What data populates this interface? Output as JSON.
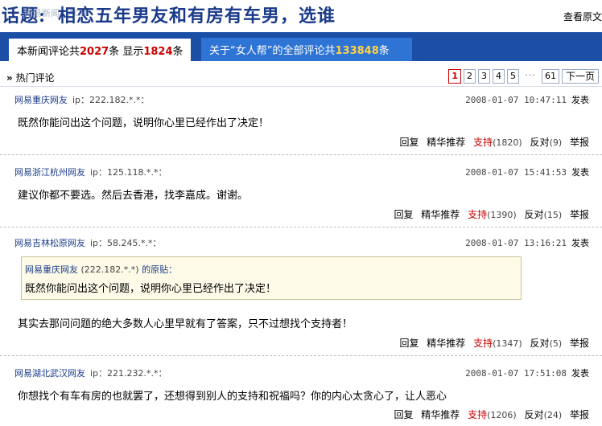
{
  "header": {
    "title_label": "话题:",
    "title": "相恋五年男友和有房有车男，选谁",
    "watermark": "网易新闻 · ACN",
    "view_link": "查看原文"
  },
  "tabs": {
    "active": {
      "prefix": "本新闻评论共",
      "count": "2027",
      "mid": "条 显示",
      "shown": "1824",
      "suffix": "条"
    },
    "inactive": {
      "prefix": "关于“女人帮”的全部评论共",
      "count": "133848",
      "suffix": "条"
    }
  },
  "hot": {
    "title": "热门评论",
    "arrow": "»",
    "pager": {
      "pages": [
        "1",
        "2",
        "3",
        "4",
        "5"
      ],
      "dots": "···",
      "last": "61",
      "next": "下一页"
    }
  },
  "comments": [
    {
      "user": "网易重庆网友",
      "ip": "ip：222.182.*.*：",
      "time": "2008-01-07 10:47:11",
      "post": "发表",
      "body": "既然你能问出这个问题，说明你心里已经作出了决定！",
      "actions": {
        "reply": "回复",
        "recommend": "精华推荐",
        "support": "支持",
        "support_count": "(1820)",
        "oppose": "反对",
        "oppose_count": "(9)",
        "report": "举报"
      }
    },
    {
      "user": "网易浙江杭州网友",
      "ip": "ip：125.118.*.*：",
      "time": "2008-01-07 15:41:53",
      "post": "发表",
      "body": "建议你都不要选。然后去香港，找李嘉成。谢谢。",
      "actions": {
        "reply": "回复",
        "recommend": "精华推荐",
        "support": "支持",
        "support_count": "(1390)",
        "oppose": "反对",
        "oppose_count": "(15)",
        "report": "举报"
      }
    },
    {
      "user": "网易吉林松原网友",
      "ip": "ip：58.245.*.*：",
      "time": "2008-01-07 13:16:21",
      "post": "发表",
      "quote": {
        "user": "网易重庆网友",
        "ip": "(222.182.*.*)",
        "label": "的原贴：",
        "body": "既然你能问出这个问题，说明你心里已经作出了决定！"
      },
      "body": "其实去那问问题的绝大多数人心里早就有了答案，只不过想找个支持者！",
      "actions": {
        "reply": "回复",
        "recommend": "精华推荐",
        "support": "支持",
        "support_count": "(1347)",
        "oppose": "反对",
        "oppose_count": "(5)",
        "report": "举报"
      }
    },
    {
      "user": "网易湖北武汉网友",
      "ip": "ip：221.232.*.*：",
      "time": "2008-01-07 17:51:08",
      "post": "发表",
      "body": "你想找个有车有房的也就罢了，还想得到别人的支持和祝福吗？你的内心太贪心了，让人恶心",
      "actions": {
        "reply": "回复",
        "recommend": "精华推荐",
        "support": "支持",
        "support_count": "(1206)",
        "oppose": "反对",
        "oppose_count": "(24)",
        "report": "举报"
      }
    }
  ]
}
